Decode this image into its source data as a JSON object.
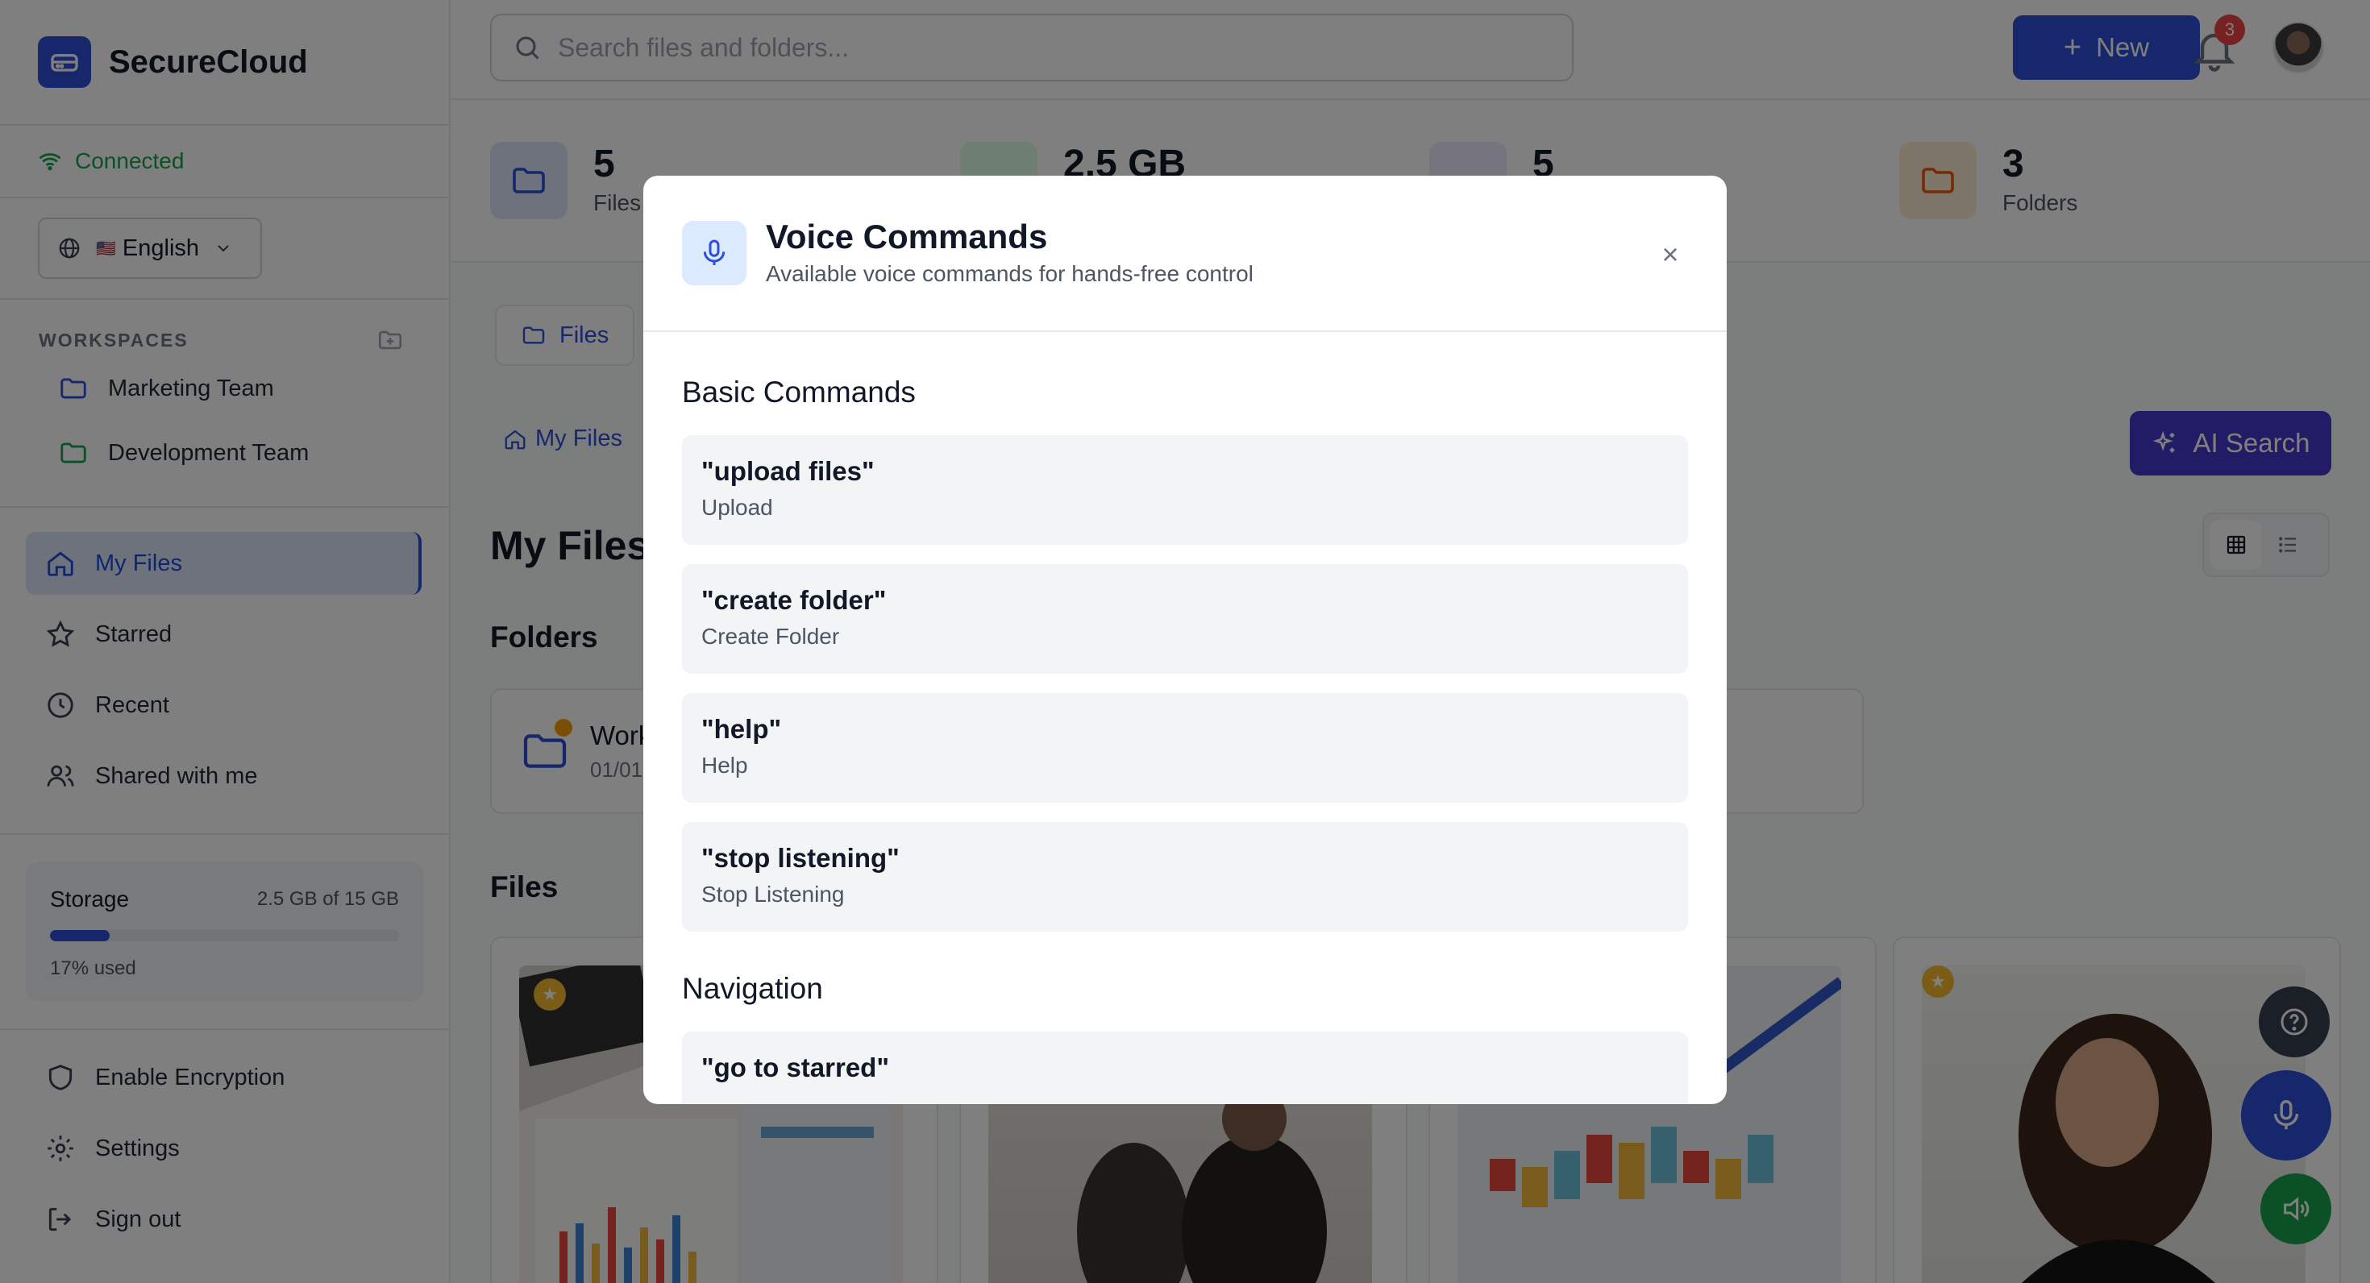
{
  "app": {
    "name": "SecureCloud"
  },
  "sidebar": {
    "connection": "Connected",
    "language": {
      "flag": "🇺🇸",
      "label": "English"
    },
    "workspaces_title": "WORKSPACES",
    "workspaces": [
      {
        "label": "Marketing Team",
        "color": "#2d4ed8"
      },
      {
        "label": "Development Team",
        "color": "#16a34a"
      }
    ],
    "nav": [
      {
        "label": "My Files",
        "active": true
      },
      {
        "label": "Starred"
      },
      {
        "label": "Recent"
      },
      {
        "label": "Shared with me"
      }
    ],
    "storage": {
      "label": "Storage",
      "amount": "2.5 GB of 15 GB",
      "used_text": "17% used",
      "used_fraction": 0.17
    },
    "bottom": [
      {
        "label": "Enable Encryption"
      },
      {
        "label": "Settings"
      },
      {
        "label": "Sign out"
      }
    ]
  },
  "topbar": {
    "search_placeholder": "Search files and folders...",
    "new_label": "New",
    "notifications": "3"
  },
  "stats": [
    {
      "value": "5",
      "label": "Files",
      "color": "#dbe4fb",
      "icon_color": "#2d4ed8"
    },
    {
      "value": "2.5 GB",
      "label": "",
      "color": "#dcfce7",
      "icon_color": "#16a34a"
    },
    {
      "value": "5",
      "label": "",
      "color": "#ede9fe",
      "icon_color": "#7c3aed"
    },
    {
      "value": "3",
      "label": "Folders",
      "color": "#ffedd5",
      "icon_color": "#ea580c"
    }
  ],
  "main": {
    "tab_files": "Files",
    "breadcrumb": "My Files",
    "ai_search": "AI Search",
    "title": "My Files",
    "folders_heading": "Folders",
    "folder": {
      "name": "Work",
      "date": "01/01"
    },
    "files_heading": "Files"
  },
  "modal": {
    "title": "Voice Commands",
    "subtitle": "Available voice commands for hands-free control",
    "close": "×",
    "group_basic": "Basic Commands",
    "basic": [
      {
        "phrase": "\"upload files\"",
        "desc": "Upload"
      },
      {
        "phrase": "\"create folder\"",
        "desc": "Create Folder"
      },
      {
        "phrase": "\"help\"",
        "desc": "Help"
      },
      {
        "phrase": "\"stop listening\"",
        "desc": "Stop Listening"
      }
    ],
    "group_nav": "Navigation",
    "nav": [
      {
        "phrase": "\"go to starred\"",
        "desc": ""
      }
    ]
  }
}
